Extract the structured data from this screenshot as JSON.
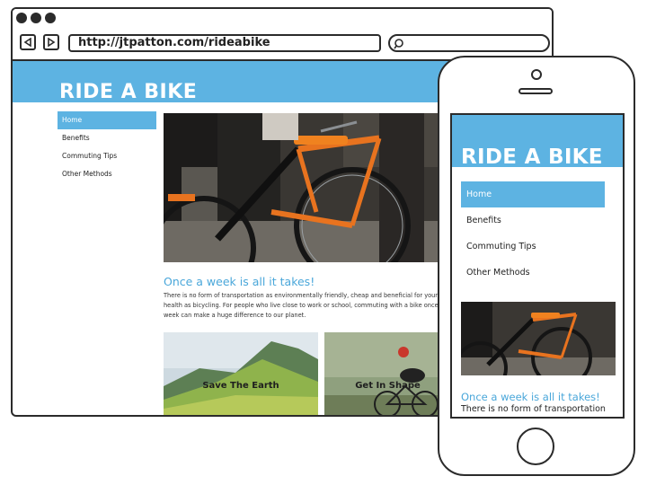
{
  "browser": {
    "url": "http://jtpatton.com/rideabike"
  },
  "site": {
    "title": "RIDE A BIKE",
    "nav": [
      {
        "label": "Home",
        "active": true
      },
      {
        "label": "Benefits",
        "active": false
      },
      {
        "label": "Commuting Tips",
        "active": false
      },
      {
        "label": "Other Methods",
        "active": false
      }
    ],
    "headline": "Once a week is all it takes!",
    "body": "There is no form of transportation as environmentally friendly, cheap and beneficial for your health as bicycling. For people who live close to work or school, commuting with a bike once a week can make a huge difference to our planet.",
    "cards": [
      {
        "label": "Save The Earth"
      },
      {
        "label": "Get In Shape"
      }
    ]
  },
  "mobile": {
    "title": "RIDE A BIKE",
    "nav": [
      {
        "label": "Home",
        "active": true
      },
      {
        "label": "Benefits",
        "active": false
      },
      {
        "label": "Commuting Tips",
        "active": false
      },
      {
        "label": "Other Methods",
        "active": false
      }
    ],
    "headline": "Once a week is all it takes!",
    "body": "There is no form of transportation"
  },
  "icons": [
    "window-dot-icon",
    "back-arrow-icon",
    "forward-arrow-icon",
    "search-icon"
  ],
  "colors": {
    "accent": "#5db3e2",
    "headline": "#4aa7da",
    "outline": "#2b2b2b",
    "bike_orange": "#e8731f"
  }
}
